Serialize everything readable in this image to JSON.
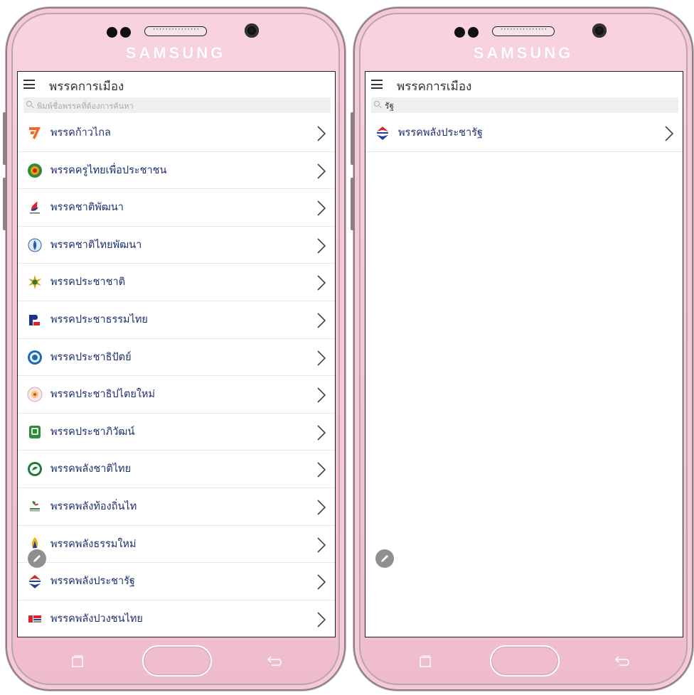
{
  "device": {
    "brand": "SAMSUNG",
    "speaker_grill": "···············"
  },
  "left_screen": {
    "title": "พรรคการเมือง",
    "search": {
      "value": "",
      "placeholder": "พิมพ์ชื่อพรรคที่ต้องการค้นหา"
    },
    "parties": [
      {
        "name": "พรรคก้าวไกล",
        "logo": "kaoklai-logo"
      },
      {
        "name": "พรรคครูไทยเพื่อประชาชน",
        "logo": "kru-thai-logo"
      },
      {
        "name": "พรรคชาติพัฒนา",
        "logo": "chart-pattana-logo"
      },
      {
        "name": "พรรคชาติไทยพัฒนา",
        "logo": "chartthai-pattana-logo"
      },
      {
        "name": "พรรคประชาชาติ",
        "logo": "prachachat-logo"
      },
      {
        "name": "พรรคประชาธรรมไทย",
        "logo": "prachatham-thai-logo"
      },
      {
        "name": "พรรคประชาธิปัตย์",
        "logo": "democrat-logo"
      },
      {
        "name": "พรรคประชาธิปไตยใหม่",
        "logo": "new-democracy-logo"
      },
      {
        "name": "พรรคประชาภิวัฒน์",
        "logo": "prachapiwat-logo"
      },
      {
        "name": "พรรคพลังชาติไทย",
        "logo": "palang-chart-thai-logo"
      },
      {
        "name": "พรรคพลังท้องถิ่นไท",
        "logo": "palang-tongtin-logo"
      },
      {
        "name": "พรรคพลังธรรมใหม่",
        "logo": "palang-tham-mai-logo"
      },
      {
        "name": "พรรคพลังประชารัฐ",
        "logo": "palang-pracharat-logo"
      },
      {
        "name": "พรรคพลังปวงชนไทย",
        "logo": "palang-puangchon-logo"
      }
    ]
  },
  "right_screen": {
    "title": "พรรคการเมือง",
    "search": {
      "value": "รัฐ",
      "placeholder": "พิมพ์ชื่อพรรคที่ต้องการค้นหา"
    },
    "parties": [
      {
        "name": "พรรคพลังประชารัฐ",
        "logo": "palang-pracharat-logo"
      }
    ]
  },
  "colors": {
    "phone_body": "#f3c5d3",
    "party_text": "#1c2f6f",
    "divider": "#e6e6e6"
  }
}
